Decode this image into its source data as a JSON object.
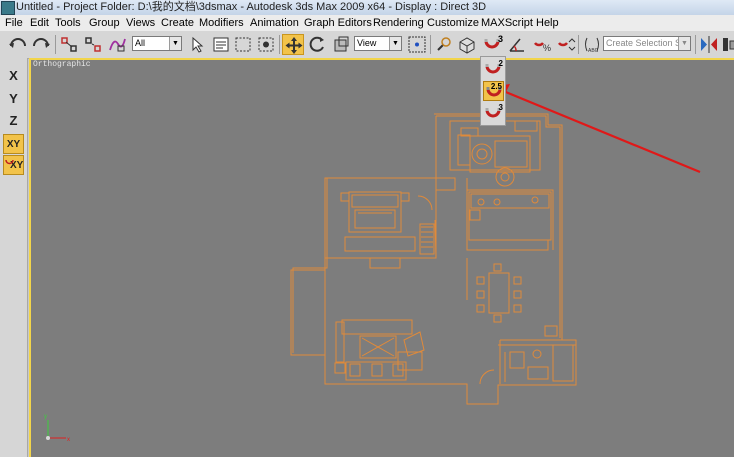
{
  "window": {
    "title": "Untitled    - Project Folder: D:\\我的文档\\3dsmax    - Autodesk 3ds Max  2009 x64      - Display : Direct 3D"
  },
  "menu": [
    "File",
    "Edit",
    "Tools",
    "Group",
    "Views",
    "Create",
    "Modifiers",
    "Animation",
    "Graph Editors",
    "Rendering",
    "Customize",
    "MAXScript",
    "Help"
  ],
  "toolbar": {
    "selection_filter": "All",
    "reference_coord": "View",
    "named_selection_placeholder": "Create Selection Set",
    "snap_label": "3"
  },
  "left_toolbar": [
    "X",
    "Y",
    "Z",
    "XY",
    "XY"
  ],
  "viewport": {
    "label": "Orthographic"
  },
  "snap_flyout": {
    "items": [
      "2",
      "2.5",
      "3"
    ],
    "selected": "2.5"
  },
  "colors": {
    "floorplan": "#e08a3a",
    "arrow": "#e01818",
    "active": "#f2c34a",
    "viewport_bg": "#7d7d7d"
  }
}
